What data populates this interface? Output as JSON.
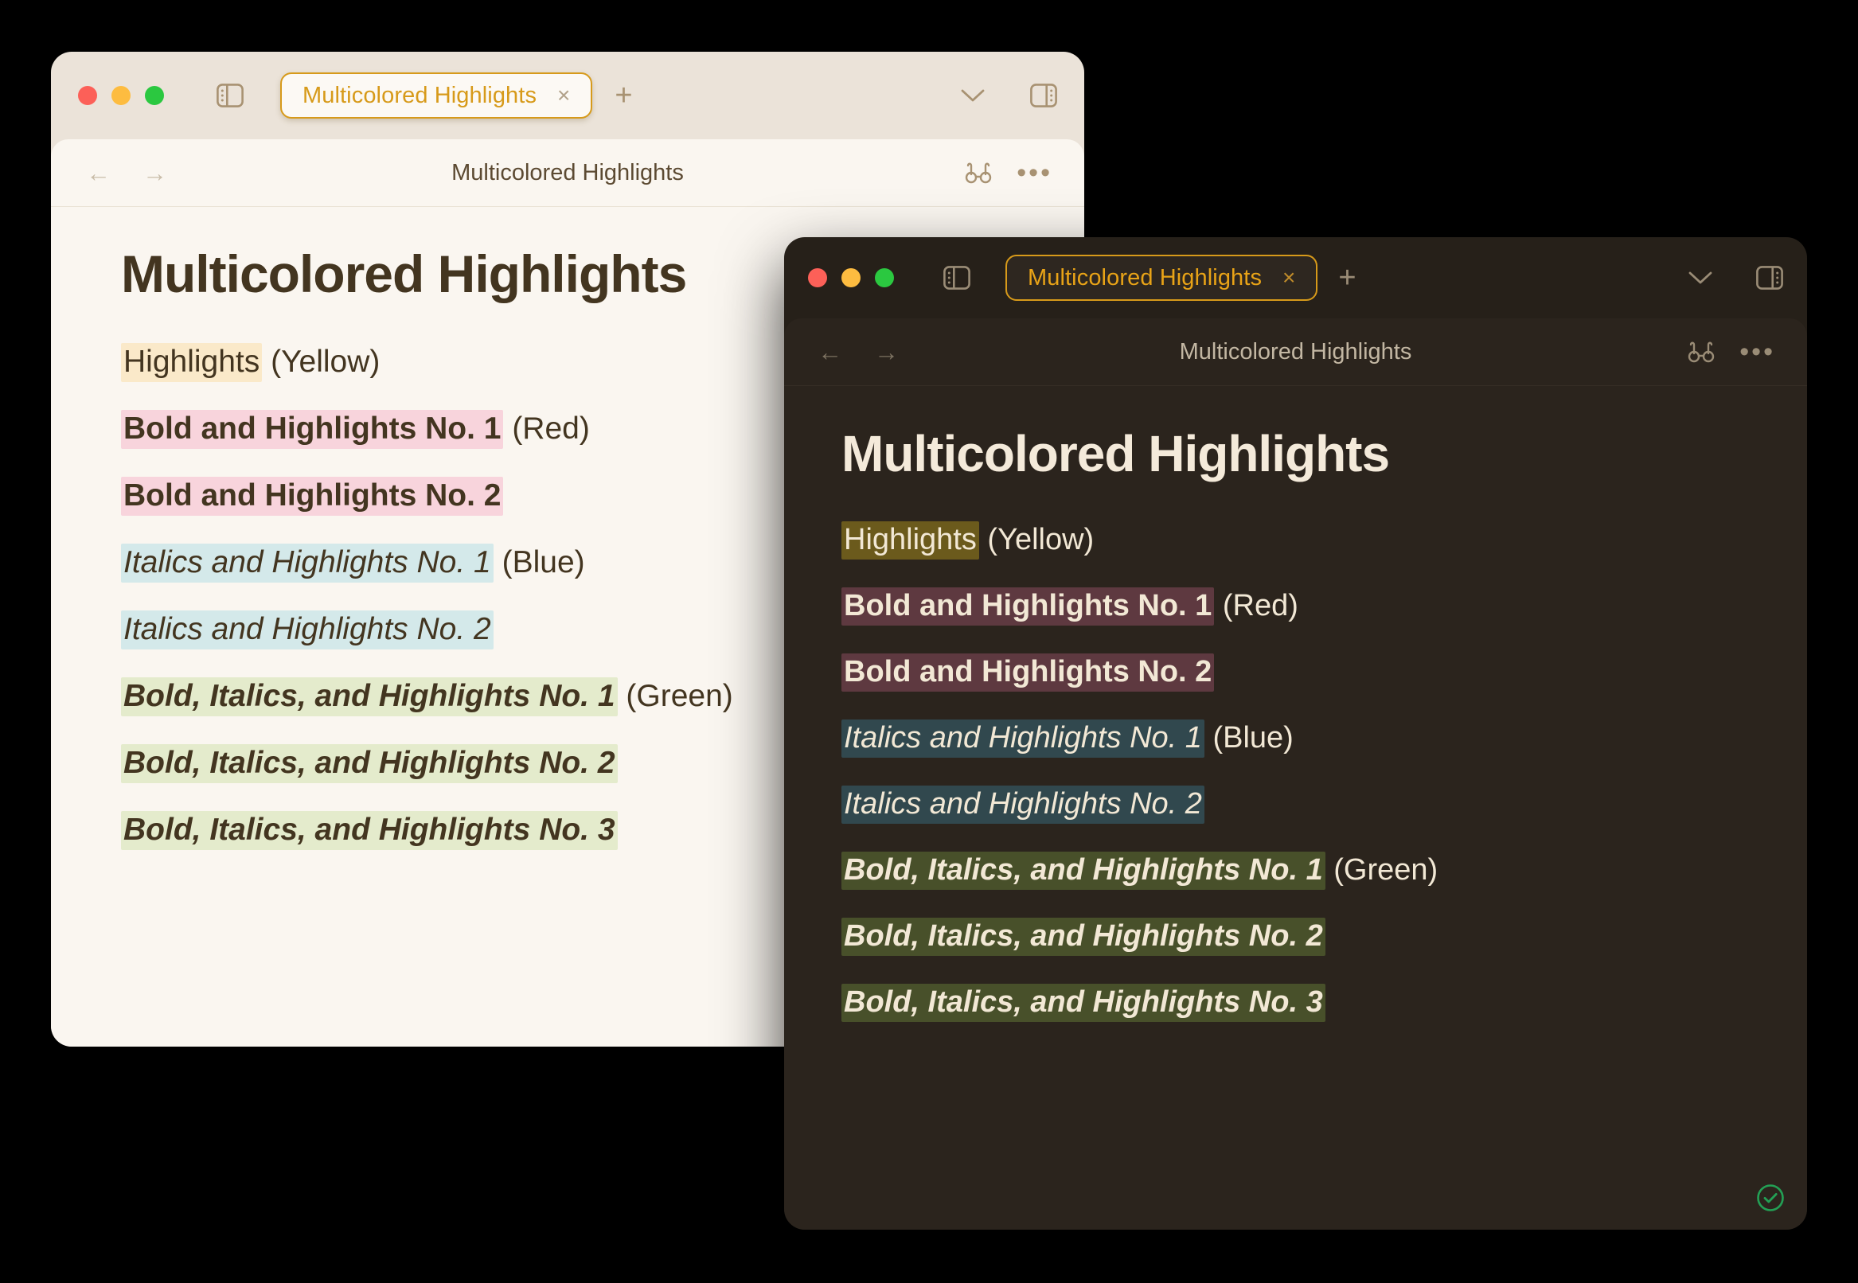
{
  "light_window": {
    "theme": "light",
    "titlebar": {
      "traffic_lights": [
        "close",
        "minimize",
        "maximize"
      ],
      "sidebar_toggle_icon": "sidebar-left-icon",
      "tab": {
        "label": "Multicolored Highlights",
        "close_glyph": "×"
      },
      "new_tab_glyph": "+",
      "chevron_glyph": "⌄",
      "sidebar_right_icon": "sidebar-right-icon"
    },
    "toolbar": {
      "back_glyph": "←",
      "forward_glyph": "→",
      "document_title": "Multicolored Highlights",
      "reading_icon": "glasses-icon",
      "more_glyph": "•••"
    },
    "document": {
      "heading": "Multicolored Highlights",
      "lines": [
        {
          "highlight": "Highlights",
          "style": "plain",
          "suffix": " (Yellow)",
          "color": "#FAE9C9"
        },
        {
          "highlight": "Bold and Highlights No. 1",
          "style": "bold",
          "suffix": " (Red)",
          "color": "#F8D4DC"
        },
        {
          "highlight": "Bold and Highlights No. 2",
          "style": "bold",
          "suffix": "",
          "color": "#F8D4DC"
        },
        {
          "highlight": "Italics and Highlights No. 1",
          "style": "italic",
          "suffix": " (Blue)",
          "color": "#D4E9EA"
        },
        {
          "highlight": "Italics and Highlights No. 2",
          "style": "italic",
          "suffix": "",
          "color": "#D4E9EA"
        },
        {
          "highlight": "Bold, Italics, and Highlights No. 1",
          "style": "bold-italic",
          "suffix": " (Green)",
          "color": "#E4EBCC"
        },
        {
          "highlight": "Bold, Italics, and Highlights No. 2",
          "style": "bold-italic",
          "suffix": "",
          "color": "#E4EBCC"
        },
        {
          "highlight": "Bold, Italics, and Highlights No. 3",
          "style": "bold-italic",
          "suffix": "",
          "color": "#E4EBCC"
        }
      ]
    }
  },
  "dark_window": {
    "theme": "dark",
    "titlebar": {
      "traffic_lights": [
        "close",
        "minimize",
        "maximize"
      ],
      "sidebar_toggle_icon": "sidebar-left-icon",
      "tab": {
        "label": "Multicolored Highlights",
        "close_glyph": "×"
      },
      "new_tab_glyph": "+",
      "chevron_glyph": "⌄",
      "sidebar_right_icon": "sidebar-right-icon"
    },
    "toolbar": {
      "back_glyph": "←",
      "forward_glyph": "→",
      "document_title": "Multicolored Highlights",
      "reading_icon": "glasses-icon",
      "more_glyph": "•••"
    },
    "document": {
      "heading": "Multicolored Highlights",
      "lines": [
        {
          "highlight": "Highlights",
          "style": "plain",
          "suffix": " (Yellow)",
          "color": "#6B5A1C"
        },
        {
          "highlight": "Bold and Highlights No. 1",
          "style": "bold",
          "suffix": " (Red)",
          "color": "#5E3940"
        },
        {
          "highlight": "Bold and Highlights No. 2",
          "style": "bold",
          "suffix": "",
          "color": "#5E3940"
        },
        {
          "highlight": "Italics and Highlights No. 1",
          "style": "italic",
          "suffix": " (Blue)",
          "color": "#31484E"
        },
        {
          "highlight": "Italics and Highlights No. 2",
          "style": "italic",
          "suffix": "",
          "color": "#31484E"
        },
        {
          "highlight": "Bold, Italics, and Highlights No. 1",
          "style": "bold-italic",
          "suffix": " (Green)",
          "color": "#48502A"
        },
        {
          "highlight": "Bold, Italics, and Highlights No. 2",
          "style": "bold-italic",
          "suffix": "",
          "color": "#48502A"
        },
        {
          "highlight": "Bold, Italics, and Highlights No. 3",
          "style": "bold-italic",
          "suffix": "",
          "color": "#48502A"
        }
      ]
    },
    "status_badge": {
      "icon": "check-circle-icon",
      "color": "#23A055"
    }
  },
  "colors": {
    "accent": "#D79A1A",
    "light_window_bg": "#EBE3D9",
    "light_page_bg": "#FAF6F0",
    "light_text": "#433520",
    "dark_window_bg": "#262019",
    "dark_page_bg": "#2B241D",
    "dark_text": "#F2E8D5",
    "desktop_bg": "#000000"
  }
}
